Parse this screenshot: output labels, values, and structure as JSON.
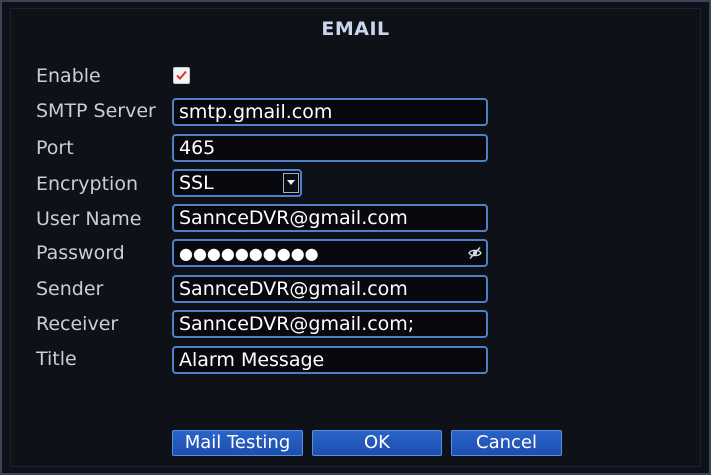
{
  "dialog": {
    "title": "EMAIL"
  },
  "form": {
    "enable": {
      "label": "Enable",
      "checked": true
    },
    "smtp_server": {
      "label": "SMTP Server",
      "value": "smtp.gmail.com"
    },
    "port": {
      "label": "Port",
      "value": "465"
    },
    "encryption": {
      "label": "Encryption",
      "value": "SSL"
    },
    "user_name": {
      "label": "User Name",
      "value": "SannceDVR@gmail.com"
    },
    "password": {
      "label": "Password",
      "value": "●●●●●●●●●●"
    },
    "sender": {
      "label": "Sender",
      "value": "SannceDVR@gmail.com"
    },
    "receiver": {
      "label": "Receiver",
      "value": "SannceDVR@gmail.com;"
    },
    "title": {
      "label": "Title",
      "value": "Alarm Message"
    }
  },
  "buttons": {
    "mail_testing": "Mail Testing",
    "ok": "OK",
    "cancel": "Cancel"
  },
  "colors": {
    "field_border": "#4f7fc4",
    "button_fill": "#2a63c9",
    "checkmark": "#e03030"
  },
  "icons": {
    "checkbox": "checkmark-icon",
    "password_toggle": "eye-slash-icon",
    "dropdown": "chevron-down-icon"
  }
}
